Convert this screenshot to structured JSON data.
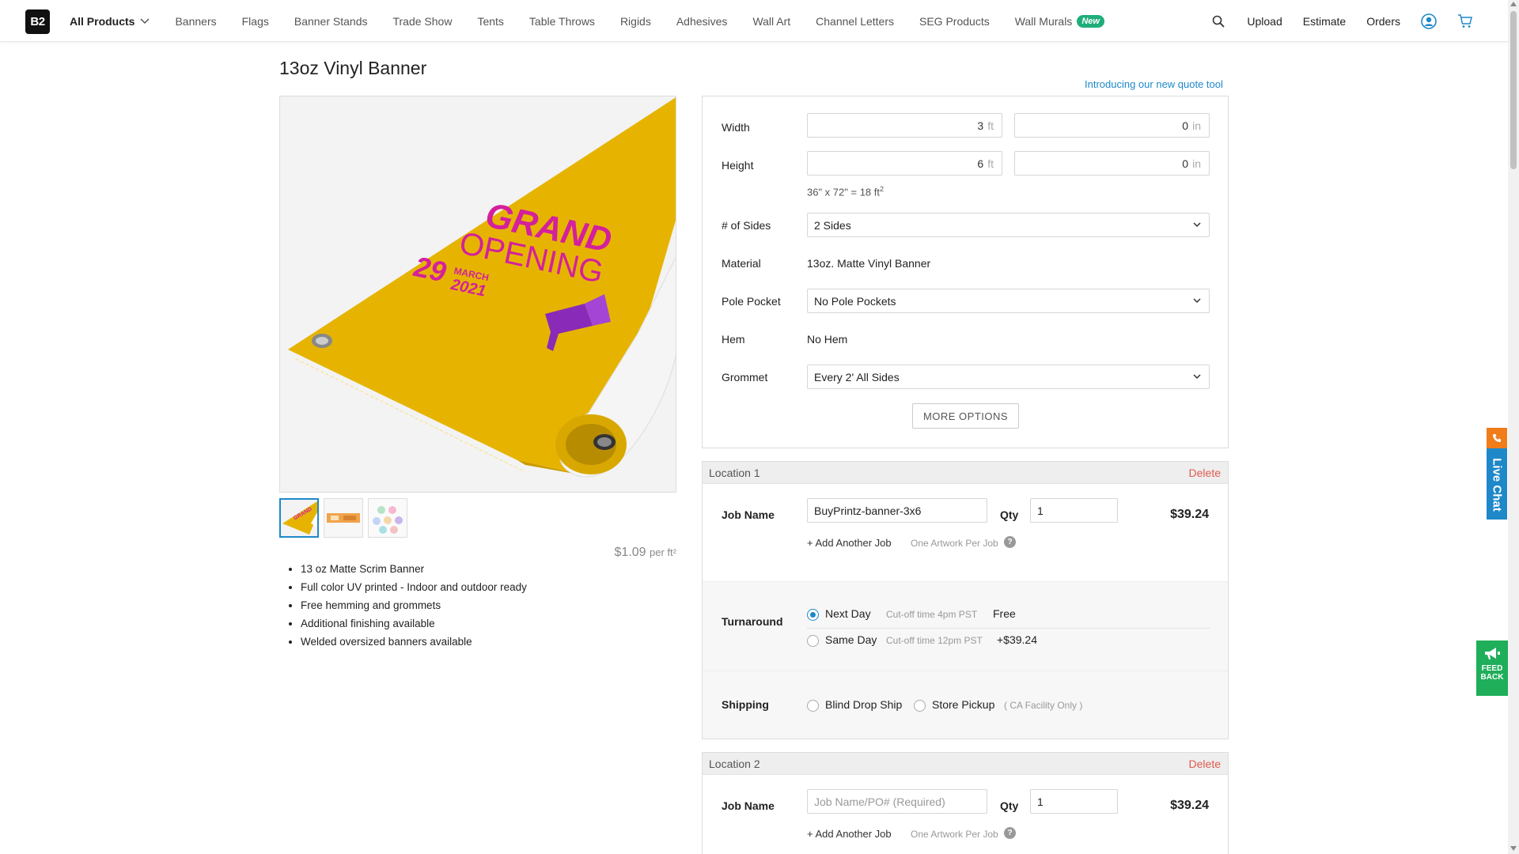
{
  "nav": {
    "logo": "B2",
    "items": [
      "All Products",
      "Banners",
      "Flags",
      "Banner Stands",
      "Trade Show",
      "Tents",
      "Table Throws",
      "Rigids",
      "Adhesives",
      "Wall Art",
      "Channel Letters",
      "SEG Products",
      "Wall Murals"
    ],
    "new_badge": "New",
    "right": {
      "upload": "Upload",
      "estimate": "Estimate",
      "orders": "Orders"
    }
  },
  "page": {
    "title": "13oz Vinyl Banner",
    "quote_link": "Introducing our new quote tool"
  },
  "product": {
    "image_text": {
      "line1": "GRAND",
      "line2": "OPENING",
      "day": "29",
      "month": "MARCH",
      "year": "2021"
    },
    "price_per": "$1.09",
    "price_unit": "per ft²",
    "features": [
      "13 oz Matte Scrim Banner",
      "Full color UV printed - Indoor and outdoor ready",
      "Free hemming and grommets",
      "Additional finishing available",
      "Welded oversized banners available"
    ]
  },
  "config": {
    "width_label": "Width",
    "width_ft": "3",
    "width_in": "0",
    "height_label": "Height",
    "height_ft": "6",
    "height_in": "0",
    "unit_ft": "ft",
    "unit_in": "in",
    "area_note": "36\" x 72\" = 18 ft",
    "area_sup": "2",
    "sides_label": "# of Sides",
    "sides_value": "2 Sides",
    "material_label": "Material",
    "material_value": "13oz. Matte Vinyl Banner",
    "pole_label": "Pole Pocket",
    "pole_value": "No Pole Pockets",
    "hem_label": "Hem",
    "hem_value": "No Hem",
    "grommet_label": "Grommet",
    "grommet_value": "Every 2' All Sides",
    "more_options": "MORE OPTIONS"
  },
  "locations": [
    {
      "title": "Location 1",
      "delete": "Delete",
      "job_label": "Job Name",
      "job_value": "BuyPrintz-banner-3x6",
      "qty_label": "Qty",
      "qty_value": "1",
      "price": "$39.24",
      "add_job": "Add Another Job",
      "one_artwork": "One Artwork Per Job",
      "turnaround_label": "Turnaround",
      "next_day": "Next Day",
      "next_cutoff": "Cut-off time 4pm PST",
      "next_price": "Free",
      "same_day": "Same Day",
      "same_cutoff": "Cut-off time 12pm PST",
      "same_price": "+$39.24",
      "shipping_label": "Shipping",
      "blind_drop": "Blind Drop Ship",
      "store_pickup": "Store Pickup",
      "ca_only": "( CA Facility Only )"
    },
    {
      "title": "Location 2",
      "delete": "Delete",
      "job_label": "Job Name",
      "job_placeholder": "Job Name/PO# (Required)",
      "qty_label": "Qty",
      "qty_value": "1",
      "price": "$39.24",
      "add_job": "Add Another Job",
      "one_artwork": "One Artwork Per Job"
    }
  ],
  "widgets": {
    "live_chat": "Live Chat",
    "feedback_line1": "FEED",
    "feedback_line2": "BACK"
  },
  "colors": {
    "accent": "#1e88c9",
    "delete": "#e05a4f",
    "new_badge": "#1fae7a",
    "banner_yellow": "#e6b400",
    "banner_magenta": "#d4209c"
  }
}
